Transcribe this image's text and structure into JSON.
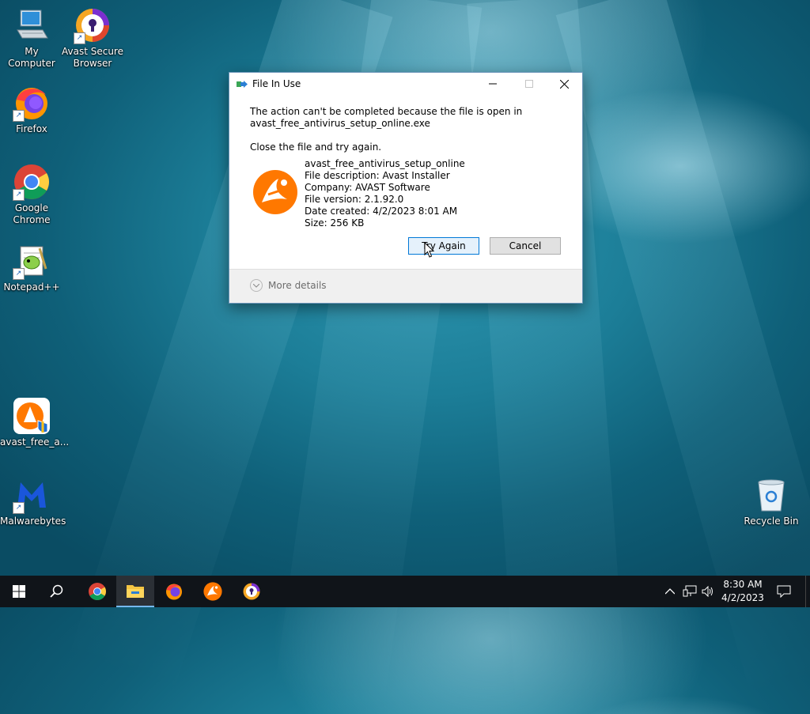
{
  "desktop": {
    "icons": {
      "my_computer": "My Computer",
      "avast_browser": "Avast Secure Browser",
      "firefox": "Firefox",
      "chrome": "Google Chrome",
      "notepadpp": "Notepad++",
      "avast_setup": "avast_free_a...",
      "malwarebytes": "Malwarebytes",
      "recycle_bin": "Recycle Bin"
    }
  },
  "dialog": {
    "title": "File In Use",
    "message_line1": "The action can't be completed because the file is open in",
    "message_line2": "avast_free_antivirus_setup_online.exe",
    "instruction": "Close the file and try again.",
    "file": {
      "name": "avast_free_antivirus_setup_online",
      "description": "File description: Avast Installer",
      "company": "Company: AVAST Software",
      "version": "File version: 2.1.92.0",
      "date_created": "Date created: 4/2/2023 8:01 AM",
      "size": "Size: 256 KB"
    },
    "buttons": {
      "try_again": "Try Again",
      "cancel": "Cancel"
    },
    "more_details": "More details"
  },
  "taskbar": {
    "clock_time": "8:30 AM",
    "clock_date": "4/2/2023"
  },
  "colors": {
    "avast_orange": "#ff7800",
    "taskbar_bg": "#101419",
    "accent": "#0078d7"
  }
}
